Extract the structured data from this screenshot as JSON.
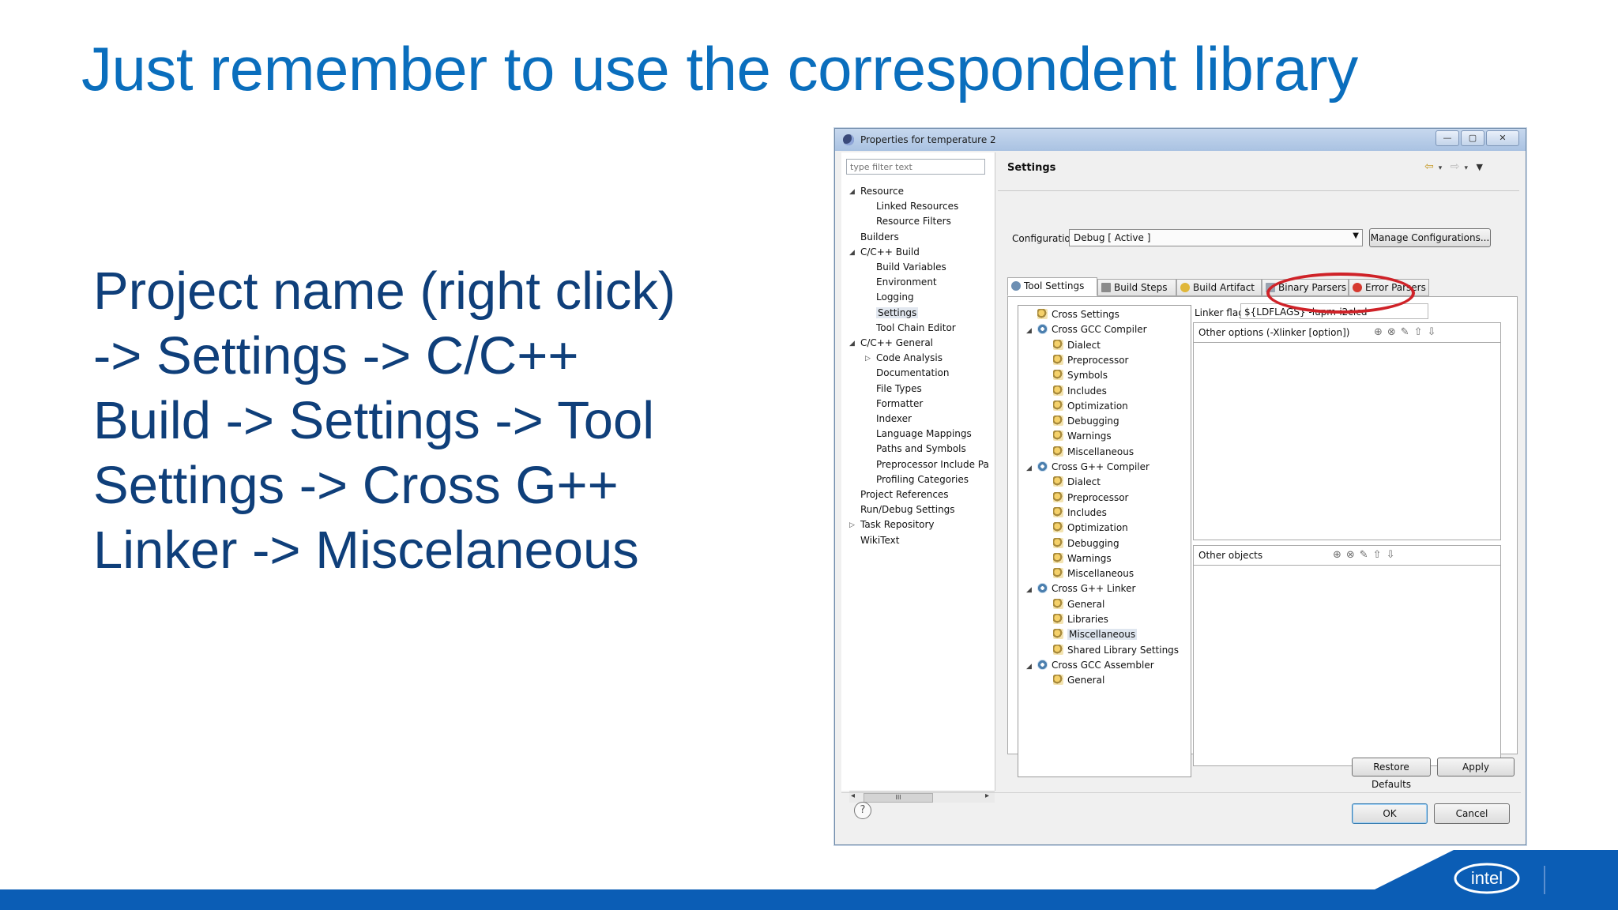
{
  "slide": {
    "title": "Just remember to use the correspondent library",
    "body_lines": [
      "Project name (right click)",
      "-> Settings -> C/C++",
      "Build -> Settings -> Tool",
      "Settings -> Cross G++",
      "Linker -> Miscelaneous"
    ],
    "brand": "intel"
  },
  "dialog": {
    "title": "Properties for temperature 2",
    "filter_placeholder": "type filter text",
    "nav_tree": [
      {
        "label": "Resource",
        "level": 0,
        "expanded": true
      },
      {
        "label": "Linked Resources",
        "level": 1
      },
      {
        "label": "Resource Filters",
        "level": 1
      },
      {
        "label": "Builders",
        "level": 0
      },
      {
        "label": "C/C++ Build",
        "level": 0,
        "expanded": true
      },
      {
        "label": "Build Variables",
        "level": 1
      },
      {
        "label": "Environment",
        "level": 1
      },
      {
        "label": "Logging",
        "level": 1
      },
      {
        "label": "Settings",
        "level": 1,
        "selected": true
      },
      {
        "label": "Tool Chain Editor",
        "level": 1
      },
      {
        "label": "C/C++ General",
        "level": 0,
        "expanded": true
      },
      {
        "label": "Code Analysis",
        "level": 1,
        "collapsed": true
      },
      {
        "label": "Documentation",
        "level": 1
      },
      {
        "label": "File Types",
        "level": 1
      },
      {
        "label": "Formatter",
        "level": 1
      },
      {
        "label": "Indexer",
        "level": 1
      },
      {
        "label": "Language Mappings",
        "level": 1
      },
      {
        "label": "Paths and Symbols",
        "level": 1
      },
      {
        "label": "Preprocessor Include Pa",
        "level": 1
      },
      {
        "label": "Profiling Categories",
        "level": 1
      },
      {
        "label": "Project References",
        "level": 0
      },
      {
        "label": "Run/Debug Settings",
        "level": 0
      },
      {
        "label": "Task Repository",
        "level": 0,
        "collapsed": true
      },
      {
        "label": "WikiText",
        "level": 0
      }
    ],
    "settings_title": "Settings",
    "config_label": "Configuration:",
    "config_value": "Debug  [ Active ]",
    "manage_btn": "Manage Configurations...",
    "tabs": [
      {
        "label": "Tool Settings",
        "active": true
      },
      {
        "label": "Build Steps"
      },
      {
        "label": "Build Artifact"
      },
      {
        "label": "Binary Parsers"
      },
      {
        "label": "Error Parsers"
      }
    ],
    "tool_tree": [
      {
        "label": "Cross Settings",
        "level": 0,
        "icon": "folder"
      },
      {
        "label": "Cross GCC Compiler",
        "level": 0,
        "icon": "gear",
        "expanded": true
      },
      {
        "label": "Dialect",
        "level": 1,
        "icon": "folder"
      },
      {
        "label": "Preprocessor",
        "level": 1,
        "icon": "folder"
      },
      {
        "label": "Symbols",
        "level": 1,
        "icon": "folder"
      },
      {
        "label": "Includes",
        "level": 1,
        "icon": "folder"
      },
      {
        "label": "Optimization",
        "level": 1,
        "icon": "folder"
      },
      {
        "label": "Debugging",
        "level": 1,
        "icon": "folder"
      },
      {
        "label": "Warnings",
        "level": 1,
        "icon": "folder"
      },
      {
        "label": "Miscellaneous",
        "level": 1,
        "icon": "folder"
      },
      {
        "label": "Cross G++ Compiler",
        "level": 0,
        "icon": "gear",
        "expanded": true
      },
      {
        "label": "Dialect",
        "level": 1,
        "icon": "folder"
      },
      {
        "label": "Preprocessor",
        "level": 1,
        "icon": "folder"
      },
      {
        "label": "Includes",
        "level": 1,
        "icon": "folder"
      },
      {
        "label": "Optimization",
        "level": 1,
        "icon": "folder"
      },
      {
        "label": "Debugging",
        "level": 1,
        "icon": "folder"
      },
      {
        "label": "Warnings",
        "level": 1,
        "icon": "folder"
      },
      {
        "label": "Miscellaneous",
        "level": 1,
        "icon": "folder"
      },
      {
        "label": "Cross G++ Linker",
        "level": 0,
        "icon": "gear",
        "expanded": true
      },
      {
        "label": "General",
        "level": 1,
        "icon": "folder"
      },
      {
        "label": "Libraries",
        "level": 1,
        "icon": "folder"
      },
      {
        "label": "Miscellaneous",
        "level": 1,
        "icon": "folder",
        "selected": true
      },
      {
        "label": "Shared Library Settings",
        "level": 1,
        "icon": "folder"
      },
      {
        "label": "Cross GCC Assembler",
        "level": 0,
        "icon": "gear",
        "expanded": true
      },
      {
        "label": "General",
        "level": 1,
        "icon": "folder"
      }
    ],
    "linker_flags_label": "Linker flags",
    "linker_flags_value": "${LDFLAGS} -lupm-i2clcd",
    "other_options_label": "Other options (-Xlinker [option])",
    "other_objects_label": "Other objects",
    "restore_btn": "Restore Defaults",
    "apply_btn": "Apply",
    "ok_btn": "OK",
    "cancel_btn": "Cancel",
    "help_glyph": "?",
    "scroll_glyph": "III",
    "win_buttons": [
      "—",
      "▢",
      "✕"
    ]
  },
  "colors": {
    "title_blue": "#0a6ebd",
    "body_blue": "#0f3f7a",
    "brand_blue": "#0b5db5",
    "highlight_red": "#cf2228"
  }
}
